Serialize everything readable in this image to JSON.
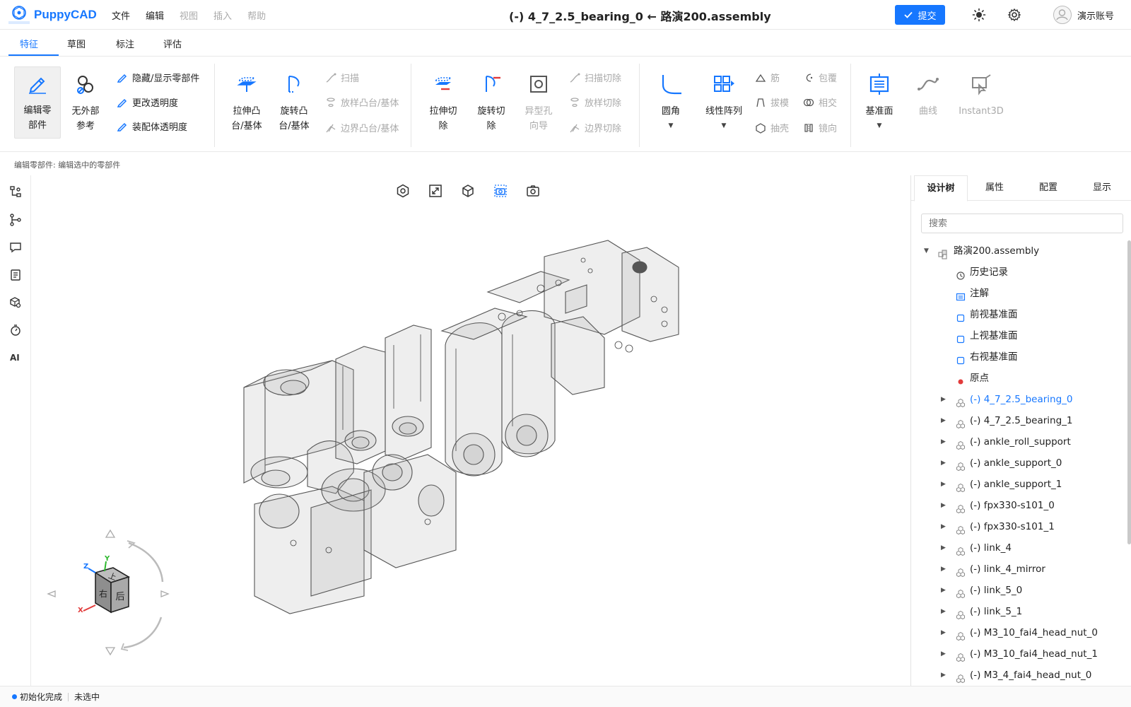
{
  "app": {
    "name": "PuppyCAD",
    "logo_subtext": "小狗智能"
  },
  "menu": {
    "items": [
      {
        "label": "文件",
        "enabled": true
      },
      {
        "label": "编辑",
        "enabled": true
      },
      {
        "label": "视图",
        "enabled": false
      },
      {
        "label": "插入",
        "enabled": false
      },
      {
        "label": "帮助",
        "enabled": false
      }
    ]
  },
  "document": {
    "title": "(-) 4_7_2.5_bearing_0 ← 路演200.assembly"
  },
  "header": {
    "submit_label": "提交",
    "account_label": "演示账号",
    "theme_icon": "sun-icon",
    "settings_icon": "gear-icon"
  },
  "tabs": [
    {
      "label": "特征",
      "active": true
    },
    {
      "label": "草图",
      "active": false
    },
    {
      "label": "标注",
      "active": false
    },
    {
      "label": "评估",
      "active": false
    }
  ],
  "ribbon": {
    "edit_part": "编辑零部件",
    "no_external_ref": "无外部参考",
    "hide_show": "隐藏/显示零部件",
    "change_transparency": "更改透明度",
    "assembly_transparency": "装配体透明度",
    "extrude_boss": "拉伸凸台/基体",
    "revolve_boss": "旋转凸台/基体",
    "sweep": "扫描",
    "loft_boss": "放样凸台/基体",
    "boundary_boss": "边界凸台/基体",
    "extrude_cut": "拉伸切除",
    "revolve_cut": "旋转切除",
    "hole_wizard": "异型孔向导",
    "sweep_cut": "扫描切除",
    "loft_cut": "放样切除",
    "boundary_cut": "边界切除",
    "fillet": "圆角",
    "linear_pattern": "线性阵列",
    "rib": "筋",
    "draft": "拔模",
    "shell": "抽壳",
    "wrap": "包覆",
    "intersect": "相交",
    "mirror": "镜向",
    "reference_plane": "基准面",
    "curve": "曲线",
    "instant3d": "Instant3D"
  },
  "hint": "编辑零部件: 编辑选中的零部件",
  "left_toolbar": {
    "icons": [
      "assembly-tree-icon",
      "branch-icon",
      "comment-icon",
      "document-list-icon",
      "box-search-icon",
      "stopwatch-icon"
    ],
    "ai_label": "AI"
  },
  "viewport": {
    "tools": [
      "view-orient-icon",
      "fit-view-icon",
      "cube-view-icon",
      "camera-view-icon",
      "screenshot-icon"
    ],
    "view_cube": {
      "top_face": "上",
      "front_face": "后",
      "side_face": "右",
      "axis_x": "X",
      "axis_y": "Y",
      "axis_z": "Z"
    }
  },
  "right_panel": {
    "tabs": [
      {
        "label": "设计树",
        "active": true
      },
      {
        "label": "属性",
        "active": false
      },
      {
        "label": "配置",
        "active": false
      },
      {
        "label": "显示",
        "active": false
      }
    ],
    "search_placeholder": "搜索",
    "tree": [
      {
        "label": "路演200.assembly",
        "level": 0,
        "type": "assembly",
        "expanded": true
      },
      {
        "label": "历史记录",
        "level": 1,
        "type": "history"
      },
      {
        "label": "注解",
        "level": 1,
        "type": "annotation"
      },
      {
        "label": "前视基准面",
        "level": 1,
        "type": "plane"
      },
      {
        "label": "上视基准面",
        "level": 1,
        "type": "plane"
      },
      {
        "label": "右视基准面",
        "level": 1,
        "type": "plane"
      },
      {
        "label": "原点",
        "level": 1,
        "type": "origin"
      },
      {
        "label": "(-) 4_7_2.5_bearing_0",
        "level": 1,
        "type": "part",
        "selected": true
      },
      {
        "label": "(-) 4_7_2.5_bearing_1",
        "level": 1,
        "type": "part"
      },
      {
        "label": "(-) ankle_roll_support",
        "level": 1,
        "type": "part"
      },
      {
        "label": "(-) ankle_support_0",
        "level": 1,
        "type": "part"
      },
      {
        "label": "(-) ankle_support_1",
        "level": 1,
        "type": "part"
      },
      {
        "label": "(-) fpx330-s101_0",
        "level": 1,
        "type": "part"
      },
      {
        "label": "(-) fpx330-s101_1",
        "level": 1,
        "type": "part"
      },
      {
        "label": "(-) link_4",
        "level": 1,
        "type": "part"
      },
      {
        "label": "(-) link_4_mirror",
        "level": 1,
        "type": "part"
      },
      {
        "label": "(-) link_5_0",
        "level": 1,
        "type": "part"
      },
      {
        "label": "(-) link_5_1",
        "level": 1,
        "type": "part"
      },
      {
        "label": "(-) M3_10_fai4_head_nut_0",
        "level": 1,
        "type": "part"
      },
      {
        "label": "(-) M3_10_fai4_head_nut_1",
        "level": 1,
        "type": "part"
      },
      {
        "label": "(-) M3_4_fai4_head_nut_0",
        "level": 1,
        "type": "part"
      }
    ]
  },
  "status": {
    "init": "初始化完成",
    "selection": "未选中"
  },
  "colors": {
    "accent": "#1677ff",
    "origin_dot": "#e23b3b",
    "selected_tree_text": "#1677ff"
  }
}
